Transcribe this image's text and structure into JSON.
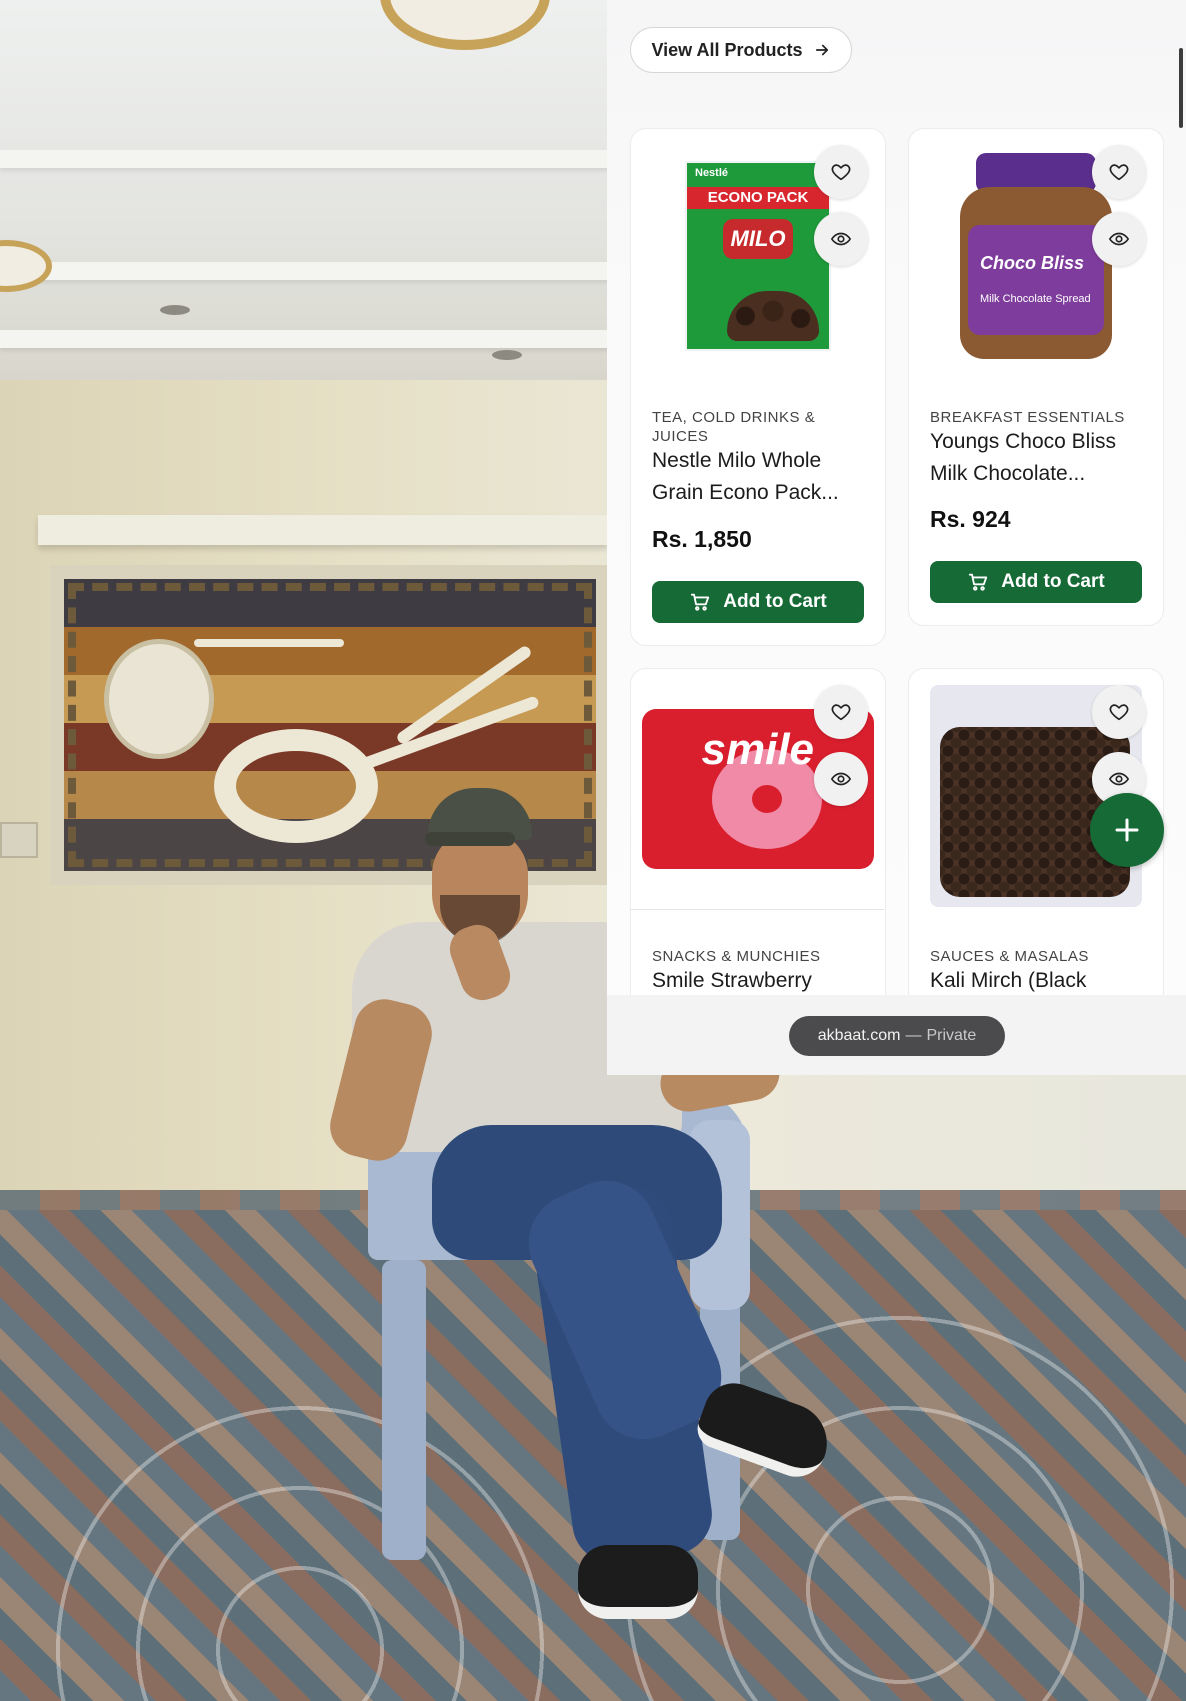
{
  "browser": {
    "view_all_label": "View All Products",
    "url_bar": {
      "domain": "akbaat.com",
      "separator": "—",
      "mode": "Private"
    }
  },
  "products": [
    {
      "category": "TEA, COLD DRINKS & JUICES",
      "name": "Nestle Milo Whole Grain Econo Pack...",
      "price": "Rs. 1,850",
      "add_label": "Add to Cart",
      "image_text": {
        "top": "Nestlé",
        "band": "ECONO PACK",
        "logo": "MILO"
      }
    },
    {
      "category": "BREAKFAST ESSENTIALS",
      "name": "Youngs Choco Bliss Milk Chocolate...",
      "price": "Rs. 924",
      "add_label": "Add to Cart",
      "image_text": {
        "logo": "Choco Bliss",
        "sub": "Milk Chocolate Spread"
      }
    },
    {
      "category": "SNACKS & MUNCHIES",
      "name": "Smile Strawberry",
      "image_text": {
        "logo": "smile"
      }
    },
    {
      "category": "SAUCES & MASALAS",
      "name": "Kali Mirch (Black"
    }
  ],
  "icons": {
    "wishlist": "heart-icon",
    "quick_view": "eye-icon",
    "cart": "cart-icon",
    "arrow": "arrow-right-icon",
    "add": "plus-icon"
  },
  "colors": {
    "brand_green": "#156a36",
    "url_pill": "#4b4b4d"
  }
}
